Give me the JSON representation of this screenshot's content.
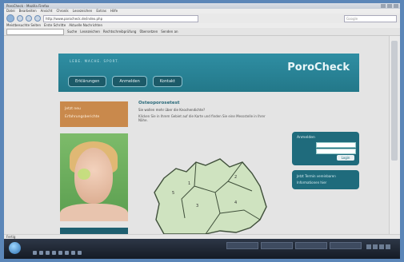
{
  "browser": {
    "title": "PoroCheck - Mozilla Firefox",
    "menu": [
      "Datei",
      "Bearbeiten",
      "Ansicht",
      "Chronik",
      "Lesezeichen",
      "Extras",
      "Hilfe"
    ],
    "address": "http://www.porocheck.de/index.php",
    "search_placeholder": "Google",
    "bookmarks": [
      "Meistbesuchte Seiten",
      "Erste Schritte",
      "Aktuelle Nachrichten"
    ],
    "toolbar_items": [
      "Suche",
      "Lesezeichen",
      "Rechtschreibprüfung",
      "Übersetzen",
      "Senden an"
    ],
    "status": "Fertig"
  },
  "site": {
    "tagline": "LEBE. MACHE. SPORT.",
    "logo": "PoroCheck",
    "nav": [
      "Erklärungen",
      "Anmelden",
      "Kontakt"
    ],
    "promo_lines": [
      "Jetzt neu",
      "Erfahrungsberichte"
    ],
    "center_title": "Osteoporosetest",
    "center_sub": "Sie wollen mehr über die Knochendichte?",
    "center_body": "Klicken Sie in Ihrem Gebiet auf die Karte und finden Sie eine Messstelle in Ihrer Nähe.",
    "login": {
      "title": "Anmelden",
      "button": "Login"
    },
    "info_lines": [
      "Jetzt Termin vereinbaren",
      "Informationen hier"
    ]
  },
  "colors": {
    "header": "#2f8ea3",
    "promo": "#c9894c",
    "boxes": "#1f6b7c",
    "map_fill": "#cfe3c0"
  }
}
